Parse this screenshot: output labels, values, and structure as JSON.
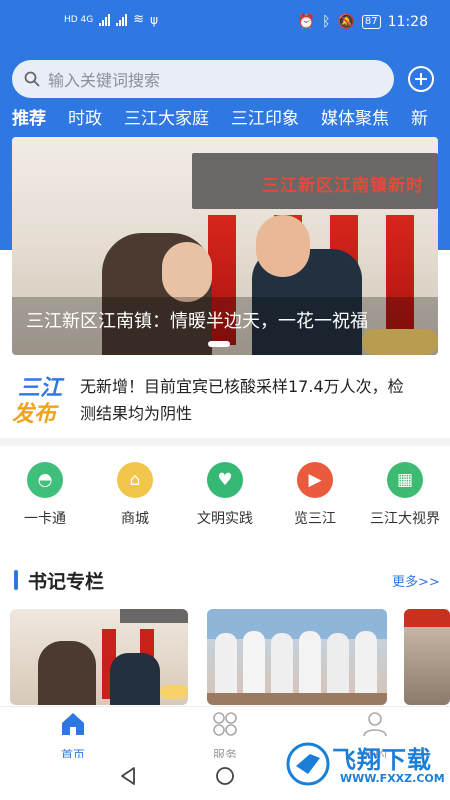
{
  "status_bar": {
    "network_left": "HD 4G",
    "battery": "87",
    "time": "11:28"
  },
  "search": {
    "placeholder": "输入关键词搜索",
    "icon": "search-icon",
    "add_icon": "plus-circle-icon"
  },
  "tabs": [
    {
      "label": "推荐",
      "active": true
    },
    {
      "label": "时政"
    },
    {
      "label": "三江大家庭"
    },
    {
      "label": "三江印象"
    },
    {
      "label": "媒体聚焦"
    },
    {
      "label": "新"
    }
  ],
  "banner": {
    "sign_text": "三江新区江南镇新时",
    "caption": "三江新区江南镇：情暖半边天，一花一祝福"
  },
  "ticker": {
    "logo_top": "三江",
    "logo_bottom": "发布",
    "text": "无新增！目前宜宾已核酸采样17.4万人次，检测结果均为阴性"
  },
  "quick_links": [
    {
      "label": "一卡通",
      "color": "#3fbf7a",
      "icon": "meal-cover-icon"
    },
    {
      "label": "商城",
      "color": "#f2c64a",
      "icon": "shop-icon"
    },
    {
      "label": "文明实践",
      "color": "#36b874",
      "icon": "heart-hand-icon"
    },
    {
      "label": "览三江",
      "color": "#ea5a3c",
      "icon": "video-camera-icon"
    },
    {
      "label": "三江大视界",
      "color": "#3dbb72",
      "icon": "film-icon"
    }
  ],
  "section": {
    "title": "书记专栏",
    "more": "更多>>"
  },
  "bottom_nav": [
    {
      "label": "首页",
      "icon": "home-icon",
      "active": true
    },
    {
      "label": "服务",
      "icon": "grid-icon"
    },
    {
      "label": "我的",
      "icon": "user-icon"
    }
  ],
  "watermark": {
    "brand": "飞翔下载",
    "url": "WWW.FXXZ.COM"
  },
  "colors": {
    "primary": "#2f78e4"
  }
}
